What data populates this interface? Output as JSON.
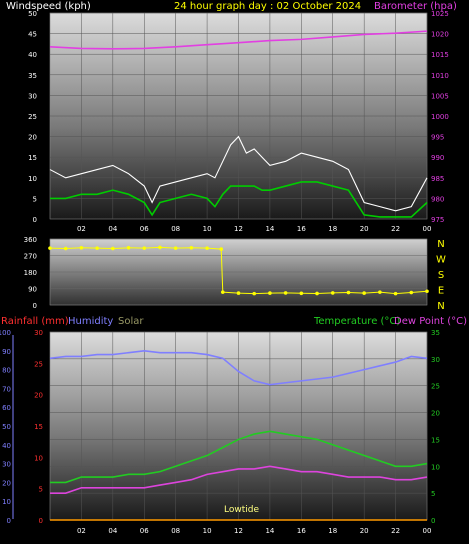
{
  "header": {
    "wind_label": "Windspeed (kph)",
    "title": "24 hour graph day : 02 October 2024",
    "baro_label": "Barometer (hpa)"
  },
  "lower_header": {
    "rain_label": "Rainfall (mm)",
    "humidity_label": "Humidity",
    "solar_label": "Solar",
    "temp_label": "Temperature (°C)",
    "dew_label": "Dew Point (°C)"
  },
  "colors": {
    "windspeed": "#ffffff",
    "windspeed_avg": "#00cc00",
    "barometer": "#e23fe2",
    "direction": "#ffff00",
    "rainfall": "#ff3030",
    "humidity": "#7f7fff",
    "solar": "#999966",
    "temperature": "#22cc22",
    "dewpoint": "#dd44dd",
    "rain_line": "#ff9900",
    "text_white": "#ffffff",
    "text_yellow": "#ffff00"
  },
  "chart_data": [
    {
      "type": "line",
      "name": "wind_baro",
      "x_ticks": [
        "02",
        "04",
        "06",
        "08",
        "10",
        "12",
        "14",
        "16",
        "18",
        "20",
        "22",
        "00"
      ],
      "y_left_ticks": [
        "0",
        "5",
        "10",
        "15",
        "20",
        "25",
        "30",
        "35",
        "40",
        "45",
        "50"
      ],
      "y_left_range": [
        0,
        50
      ],
      "y_right_ticks": [
        "975",
        "980",
        "985",
        "990",
        "995",
        "1000",
        "1005",
        "1010",
        "1015",
        "1020",
        "1025"
      ],
      "y_right_range": [
        975,
        1025
      ],
      "x_range_hours": [
        0,
        24
      ],
      "series": [
        {
          "name": "Windspeed (kph)",
          "axis": "left",
          "x": [
            0,
            1,
            2,
            3,
            4,
            5,
            6,
            6.5,
            7,
            8,
            9,
            10,
            10.5,
            11,
            11.5,
            12,
            12.5,
            13,
            13.5,
            14,
            15,
            16,
            17,
            18,
            19,
            19.5,
            20,
            21,
            22,
            23,
            24
          ],
          "y": [
            12,
            10,
            11,
            12,
            13,
            11,
            8,
            4,
            8,
            9,
            10,
            11,
            10,
            14,
            18,
            20,
            16,
            17,
            15,
            13,
            14,
            16,
            15,
            14,
            12,
            8,
            4,
            3,
            2,
            3,
            10
          ]
        },
        {
          "name": "Windspeed avg",
          "axis": "left",
          "x": [
            0,
            1,
            2,
            3,
            4,
            5,
            6,
            6.5,
            7,
            8,
            9,
            10,
            10.5,
            11,
            11.5,
            12,
            12.5,
            13,
            13.5,
            14,
            15,
            16,
            17,
            18,
            19,
            19.5,
            20,
            21,
            22,
            23,
            24
          ],
          "y": [
            5,
            5,
            6,
            6,
            7,
            6,
            4,
            1,
            4,
            5,
            6,
            5,
            3,
            6,
            8,
            8,
            8,
            8,
            7,
            7,
            8,
            9,
            9,
            8,
            7,
            4,
            1,
            0.5,
            0.5,
            0.5,
            4
          ]
        },
        {
          "name": "Barometer (hpa)",
          "axis": "right",
          "x": [
            0,
            2,
            4,
            6,
            8,
            10,
            12,
            14,
            16,
            18,
            20,
            22,
            24
          ],
          "y": [
            1016.8,
            1016.4,
            1016.3,
            1016.4,
            1016.8,
            1017.3,
            1017.8,
            1018.3,
            1018.6,
            1019.2,
            1019.8,
            1020.1,
            1020.6
          ]
        }
      ]
    },
    {
      "type": "scatter",
      "name": "wind_direction",
      "y_left_ticks": [
        "0",
        "90",
        "180",
        "270",
        "360"
      ],
      "y_right_labels": [
        "N",
        "W",
        "S",
        "E",
        "N"
      ],
      "y_range": [
        0,
        360
      ],
      "x_range_hours": [
        0,
        24
      ],
      "series": [
        {
          "name": "Wind direction",
          "x": [
            0,
            1,
            2,
            3,
            4,
            5,
            6,
            7,
            8,
            9,
            10,
            10.9,
            11,
            12,
            13,
            14,
            15,
            16,
            17,
            18,
            19,
            20,
            21,
            22,
            23,
            24
          ],
          "y": [
            310,
            308,
            312,
            310,
            308,
            312,
            310,
            314,
            310,
            312,
            310,
            305,
            70,
            65,
            62,
            65,
            66,
            64,
            63,
            66,
            68,
            65,
            70,
            62,
            68,
            75
          ]
        }
      ]
    },
    {
      "type": "line",
      "name": "temp_humidity",
      "x_ticks": [
        "02",
        "04",
        "06",
        "08",
        "10",
        "12",
        "14",
        "16",
        "18",
        "20",
        "22",
        "00"
      ],
      "y_left_hum_ticks": [
        "0",
        "10",
        "20",
        "30",
        "40",
        "50",
        "60",
        "70",
        "80",
        "90",
        "100"
      ],
      "y_left_hum_range": [
        0,
        100
      ],
      "y_left_rain_ticks": [
        "0",
        "5",
        "10",
        "15",
        "20",
        "25",
        "30"
      ],
      "y_left_rain_range": [
        0,
        30
      ],
      "y_right_ticks": [
        "0",
        "5",
        "10",
        "15",
        "20",
        "25",
        "30",
        "35"
      ],
      "y_right_range": [
        0,
        35
      ],
      "annotation": "Lowtide",
      "series": [
        {
          "name": "Humidity",
          "x": [
            0,
            1,
            2,
            3,
            4,
            5,
            6,
            7,
            8,
            9,
            10,
            11,
            12,
            13,
            14,
            15,
            16,
            17,
            18,
            19,
            20,
            21,
            22,
            23,
            24
          ],
          "y": [
            86,
            87,
            87,
            88,
            88,
            89,
            90,
            89,
            89,
            89,
            88,
            86,
            79,
            74,
            72,
            73,
            74,
            75,
            76,
            78,
            80,
            82,
            84,
            87,
            86
          ]
        },
        {
          "name": "Temperature (°C)",
          "x": [
            0,
            1,
            2,
            3,
            4,
            5,
            6,
            7,
            8,
            9,
            10,
            11,
            12,
            13,
            14,
            15,
            16,
            17,
            18,
            19,
            20,
            21,
            22,
            23,
            24
          ],
          "y": [
            7,
            7,
            8,
            8,
            8,
            8.5,
            8.5,
            9,
            10,
            11,
            12,
            13.5,
            15,
            16,
            16.5,
            16,
            15.5,
            15,
            14,
            13,
            12,
            11,
            10,
            10,
            10.5
          ]
        },
        {
          "name": "Dew Point (°C)",
          "x": [
            0,
            1,
            2,
            3,
            4,
            5,
            6,
            7,
            8,
            9,
            10,
            11,
            12,
            13,
            14,
            15,
            16,
            17,
            18,
            19,
            20,
            21,
            22,
            23,
            24
          ],
          "y": [
            5,
            5,
            6,
            6,
            6,
            6,
            6,
            6.5,
            7,
            7.5,
            8.5,
            9,
            9.5,
            9.5,
            10,
            9.5,
            9,
            9,
            8.5,
            8,
            8,
            8,
            7.5,
            7.5,
            8
          ]
        },
        {
          "name": "Rainfall (mm)",
          "x": [
            0,
            24
          ],
          "y": [
            0,
            0
          ]
        }
      ]
    }
  ]
}
